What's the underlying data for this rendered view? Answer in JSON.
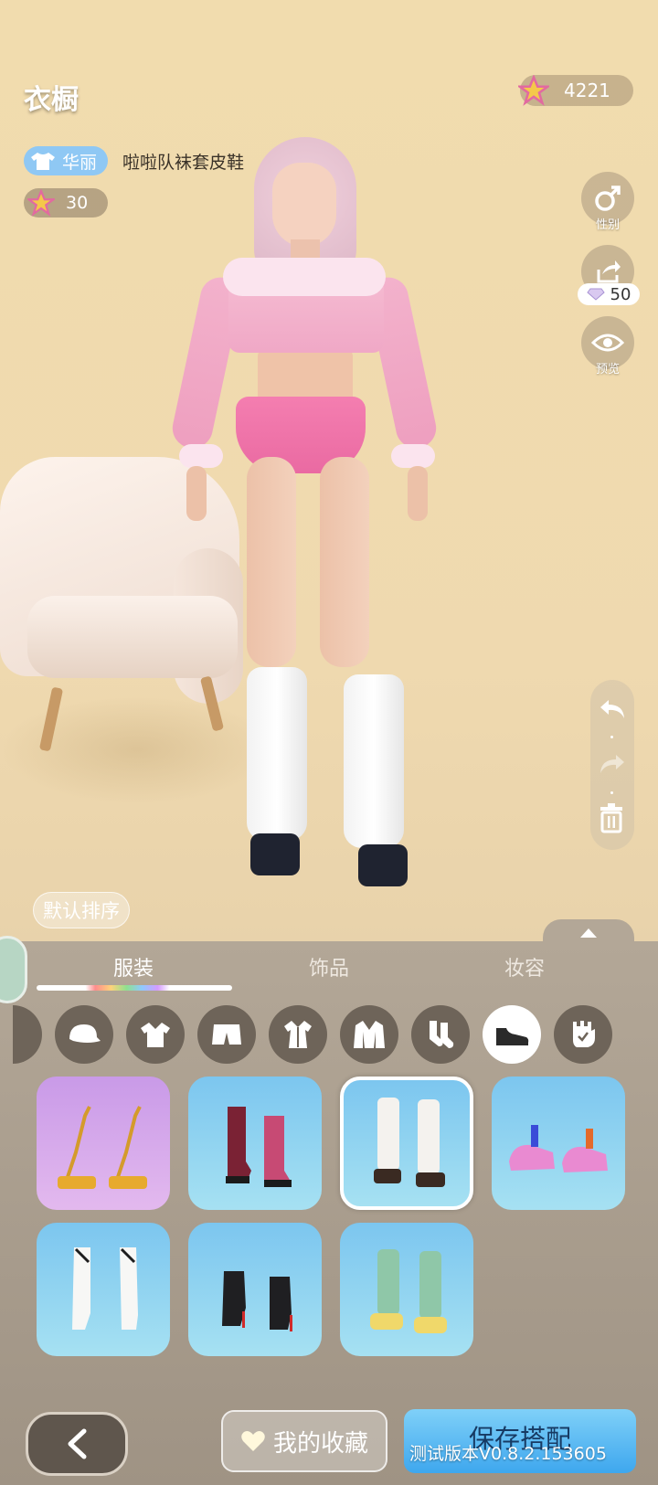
{
  "header": {
    "title": "衣橱",
    "currency_amount": "4221"
  },
  "outfit": {
    "style_tag": "华丽",
    "name": "啦啦队袜套皮鞋",
    "score": "30"
  },
  "side_buttons": {
    "gender_label": "性别",
    "share_cost": "50",
    "preview_label": "预览"
  },
  "sort": {
    "label": "默认排序"
  },
  "category_tabs": [
    "服装",
    "饰品",
    "妆容"
  ],
  "active_category": "服装",
  "sub_categories": [
    "hat-icon",
    "shirt-icon",
    "shorts-icon",
    "dress-icon",
    "jacket-icon",
    "socks-icon",
    "shoe-icon",
    "glove-icon"
  ],
  "active_sub_category": "shoe-icon",
  "items": [
    {
      "name": "golden-strappy-heels",
      "bg": "purple",
      "selected": false
    },
    {
      "name": "star-ankle-boots",
      "bg": "blue",
      "selected": false
    },
    {
      "name": "leg-warmer-shoes",
      "bg": "blue",
      "selected": true
    },
    {
      "name": "pink-chunky-sneakers",
      "bg": "blue",
      "selected": false
    },
    {
      "name": "white-knee-boots",
      "bg": "blue",
      "selected": false
    },
    {
      "name": "black-ankle-boots",
      "bg": "blue",
      "selected": false
    },
    {
      "name": "green-warmer-sneakers",
      "bg": "blue",
      "selected": false
    }
  ],
  "footer": {
    "favorites_label": "我的收藏",
    "save_label": "保存搭配",
    "version": "测试版本V0.8.2.153605"
  },
  "colors": {
    "accent": "#3ea7ee",
    "style_tag": "#8fc8f4",
    "panel": "#a89c8c"
  }
}
